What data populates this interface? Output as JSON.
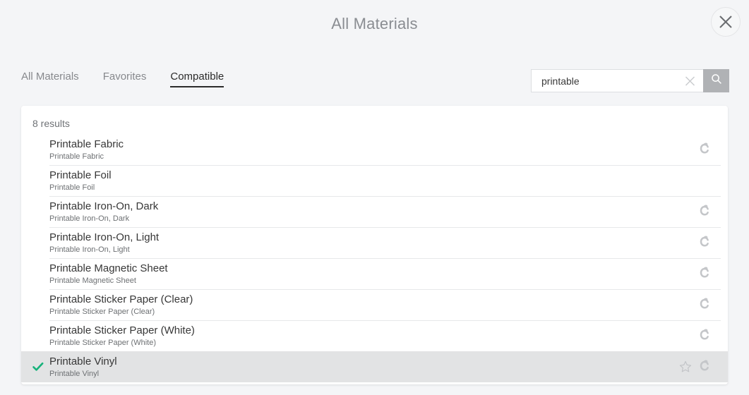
{
  "header": {
    "title": "All Materials",
    "close_icon": "close-icon"
  },
  "tabs": [
    {
      "label": "All Materials",
      "active": false
    },
    {
      "label": "Favorites",
      "active": false
    },
    {
      "label": "Compatible",
      "active": true
    }
  ],
  "search": {
    "value": "printable",
    "placeholder": "",
    "clear_icon": "close-icon",
    "search_icon": "search-icon",
    "button_color": "#b0b2b5"
  },
  "results": {
    "count_label": "8 results",
    "selected_color": "#e2e3e4",
    "check_color": "#17b27b",
    "rows": [
      {
        "title": "Printable Fabric",
        "subtitle": "Printable Fabric",
        "selected": false,
        "favorite": false,
        "brand_icon": true
      },
      {
        "title": "Printable Foil",
        "subtitle": "Printable Foil",
        "selected": false,
        "favorite": false,
        "brand_icon": false
      },
      {
        "title": "Printable Iron-On, Dark",
        "subtitle": "Printable Iron-On, Dark",
        "selected": false,
        "favorite": false,
        "brand_icon": true
      },
      {
        "title": "Printable Iron-On, Light",
        "subtitle": "Printable Iron-On, Light",
        "selected": false,
        "favorite": false,
        "brand_icon": true
      },
      {
        "title": "Printable Magnetic Sheet",
        "subtitle": "Printable Magnetic Sheet",
        "selected": false,
        "favorite": false,
        "brand_icon": true
      },
      {
        "title": "Printable Sticker Paper (Clear)",
        "subtitle": "Printable Sticker Paper (Clear)",
        "selected": false,
        "favorite": false,
        "brand_icon": true
      },
      {
        "title": "Printable Sticker Paper (White)",
        "subtitle": "Printable Sticker Paper (White)",
        "selected": false,
        "favorite": false,
        "brand_icon": true
      },
      {
        "title": "Printable Vinyl",
        "subtitle": "Printable Vinyl",
        "selected": true,
        "favorite": true,
        "brand_icon": true
      }
    ]
  }
}
